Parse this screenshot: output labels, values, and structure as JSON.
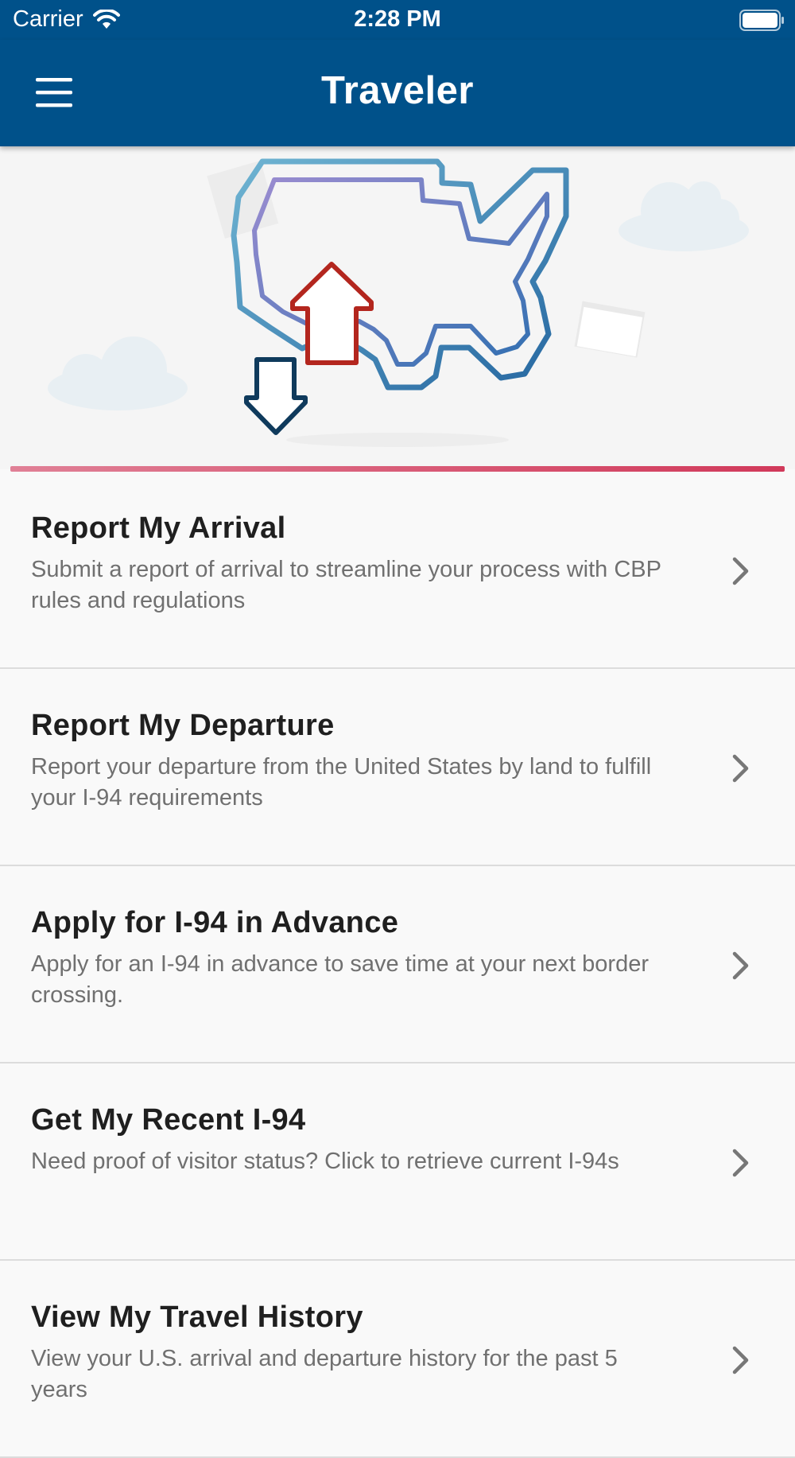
{
  "status_bar": {
    "carrier": "Carrier",
    "time": "2:28 PM",
    "wifi_icon": "wifi-icon",
    "battery_icon": "battery-full-icon"
  },
  "nav": {
    "title": "Traveler",
    "menu_icon": "hamburger-menu-icon"
  },
  "colors": {
    "brand_blue": "#00518a",
    "accent_red": "#d1395a",
    "arrow_red": "#b3261e",
    "arrow_navy": "#0f3a5c"
  },
  "menu": {
    "chevron_icon": "chevron-right-icon",
    "items": [
      {
        "title": "Report My Arrival",
        "description": "Submit a report of arrival to streamline your process with CBP rules and regulations"
      },
      {
        "title": "Report My Departure",
        "description": "Report your departure from the United States by land to fulfill your I-94 requirements"
      },
      {
        "title": "Apply for I-94 in Advance",
        "description": "Apply for an I-94 in advance to save time at your next border crossing."
      },
      {
        "title": "Get My Recent I-94",
        "description": "Need proof of visitor status? Click to retrieve current I-94s"
      },
      {
        "title": "View My Travel History",
        "description": "View your U.S. arrival and departure history for the past 5 years"
      }
    ]
  }
}
